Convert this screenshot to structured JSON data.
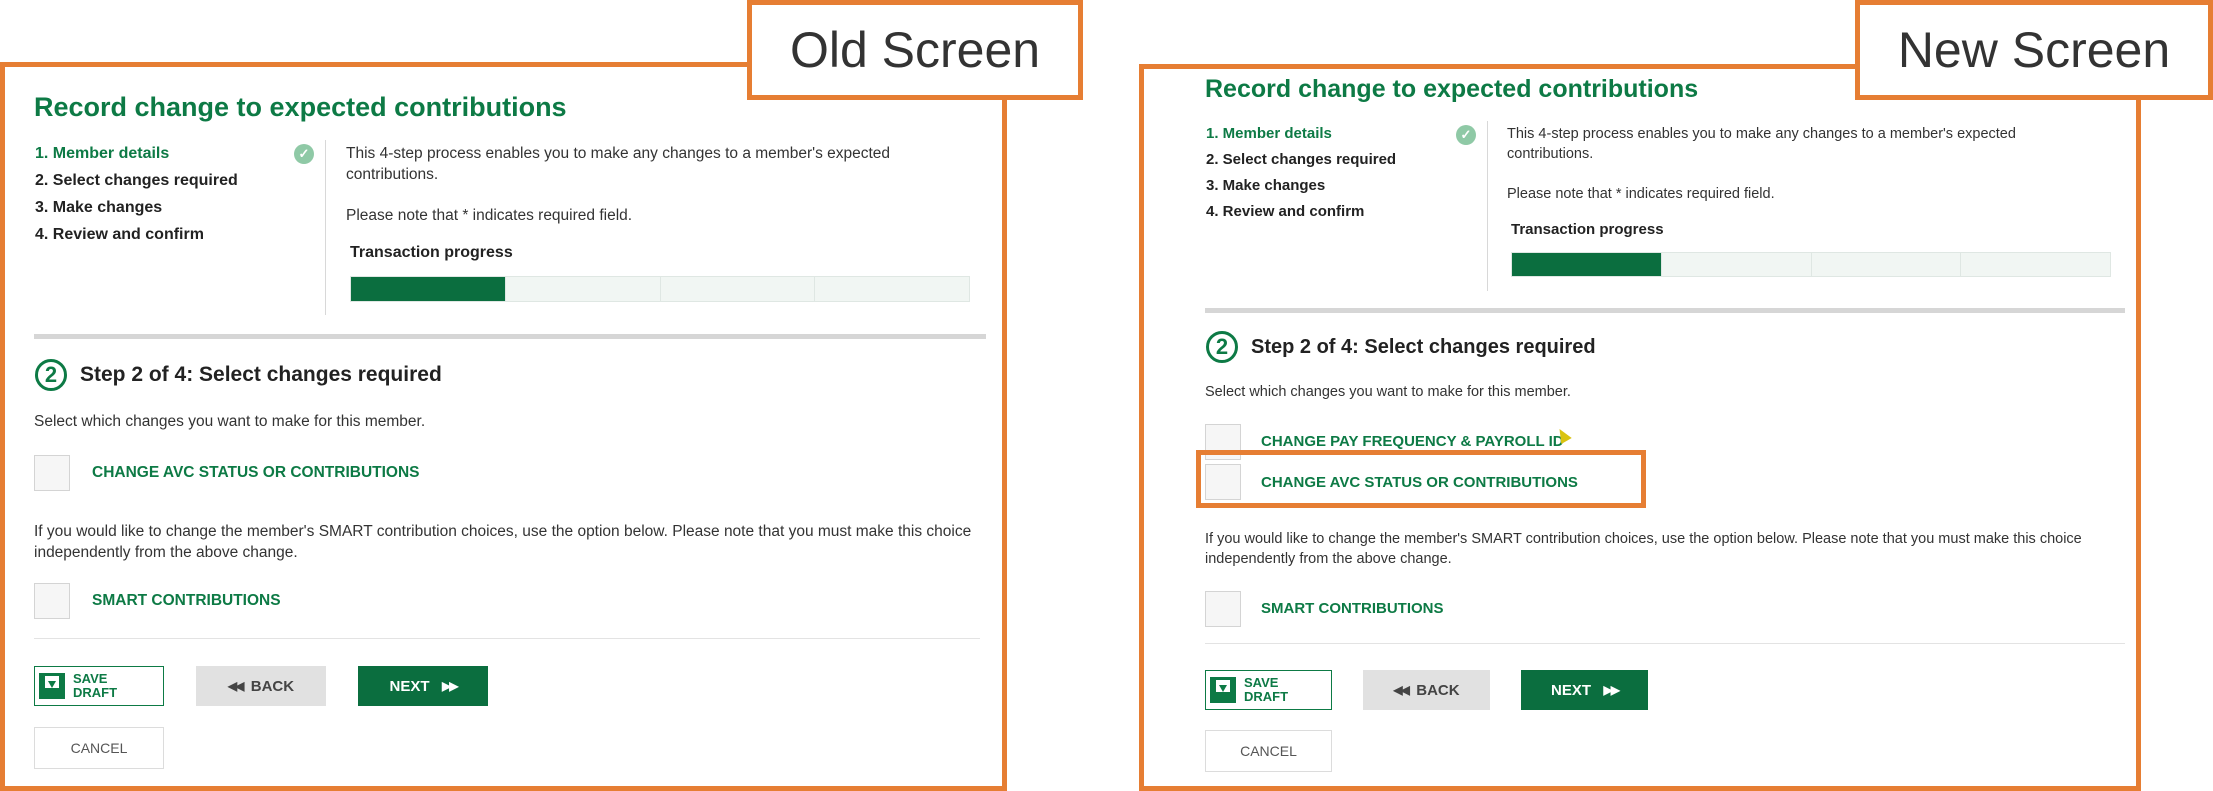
{
  "old": {
    "tag": "Old Screen",
    "title": "Record change to expected contributions",
    "steps": [
      "1. Member details",
      "2. Select changes required",
      "3. Make changes",
      "4. Review and confirm"
    ],
    "intro": "This 4-step process enables you to make any changes to a member's expected contributions.",
    "required_note": "Please note that * indicates required field.",
    "progress_label": "Transaction progress",
    "progress_done": 1,
    "progress_total": 4,
    "step_number": "2",
    "step_title": "Step 2 of 4: Select changes required",
    "select_prompt": "Select which changes you want to make for this member.",
    "option_avc": "CHANGE AVC STATUS OR CONTRIBUTIONS",
    "smart_note": "If you would like to change the member's SMART contribution choices, use the option below. Please note that you must make this choice independently from the above change.",
    "option_smart": "SMART CONTRIBUTIONS",
    "save_line1": "SAVE",
    "save_line2": "DRAFT",
    "back": "BACK",
    "next": "NEXT",
    "cancel": "CANCEL"
  },
  "new": {
    "tag": "New Screen",
    "title": "Record change to expected contributions",
    "steps": [
      "1. Member details",
      "2. Select changes required",
      "3. Make changes",
      "4. Review and confirm"
    ],
    "intro": "This 4-step process enables you to make any changes to a member's expected contributions.",
    "required_note": "Please note that * indicates required field.",
    "progress_label": "Transaction progress",
    "progress_done": 1,
    "progress_total": 4,
    "step_number": "2",
    "step_title": "Step 2 of 4: Select changes required",
    "select_prompt": "Select which changes you want to make for this member.",
    "option_pay": "CHANGE PAY FREQUENCY & PAYROLL ID",
    "option_avc": "CHANGE AVC STATUS OR CONTRIBUTIONS",
    "smart_note": "If you would like to change the member's SMART contribution choices, use the option below. Please note that you must make this choice independently from the above change.",
    "option_smart": "SMART CONTRIBUTIONS",
    "save_line1": "SAVE",
    "save_line2": "DRAFT",
    "back": "BACK",
    "next": "NEXT",
    "cancel": "CANCEL"
  },
  "colors": {
    "accent": "#e67e33",
    "brand_green": "#0d7a45",
    "check": "#8fc9a6"
  },
  "icons": {
    "complete": "check-icon",
    "save": "save-icon",
    "back": "rewind-icon",
    "next": "fast-forward-icon"
  }
}
